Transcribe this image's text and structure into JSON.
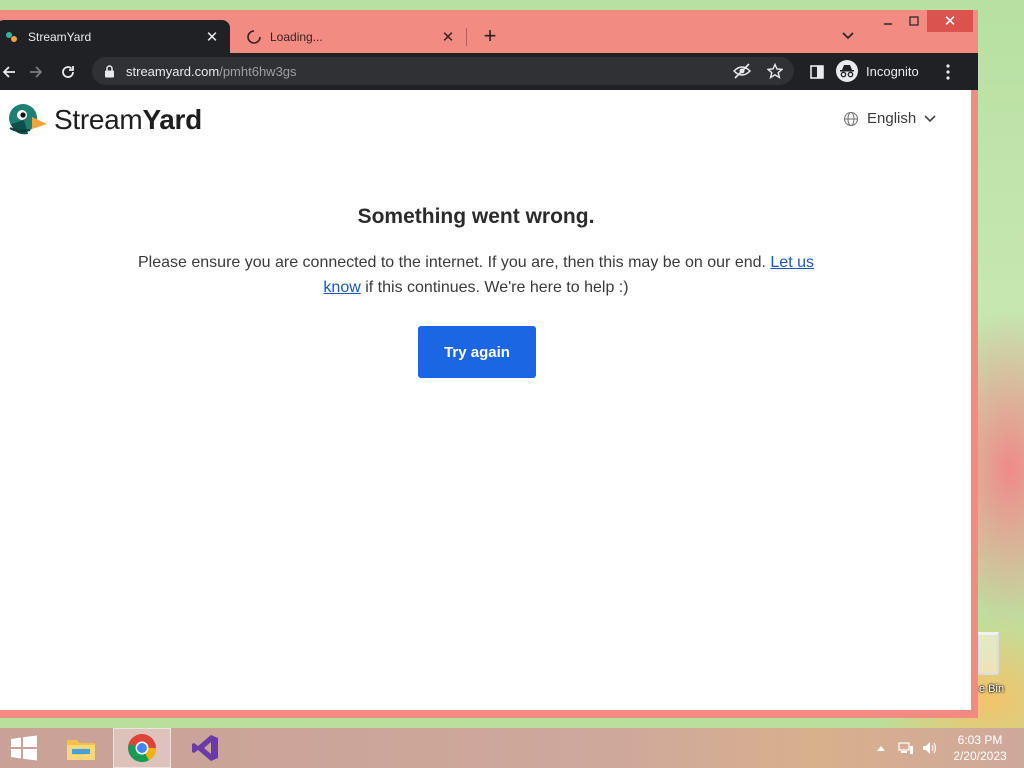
{
  "browser": {
    "tabs": [
      {
        "title": "StreamYard",
        "active": true
      },
      {
        "title": "Loading...",
        "active": false
      }
    ],
    "url": {
      "domain": "streamyard.com",
      "path": "/pmht6hw3gs"
    },
    "profile_label": "Incognito",
    "colors": {
      "frame": "#f28b82",
      "toolbar": "#202124",
      "omnibox": "#303134"
    }
  },
  "page": {
    "brand": {
      "light": "Stream",
      "bold": "Yard"
    },
    "language": "English",
    "error_title": "Something went wrong.",
    "error_msg_before": "Please ensure you are connected to the internet. If you are, then this may be on our end. ",
    "error_link": "Let us know",
    "error_msg_after": " if this continues. We're here to help :)",
    "try_again_label": "Try again",
    "accent": "#1b66e3"
  },
  "desktop": {
    "recycle_bin_label": "e Bin"
  },
  "taskbar": {
    "apps": [
      "start-button",
      "file-explorer",
      "chrome",
      "visual-studio"
    ],
    "clock_time": "6:03 PM",
    "clock_date": "2/20/2023"
  }
}
